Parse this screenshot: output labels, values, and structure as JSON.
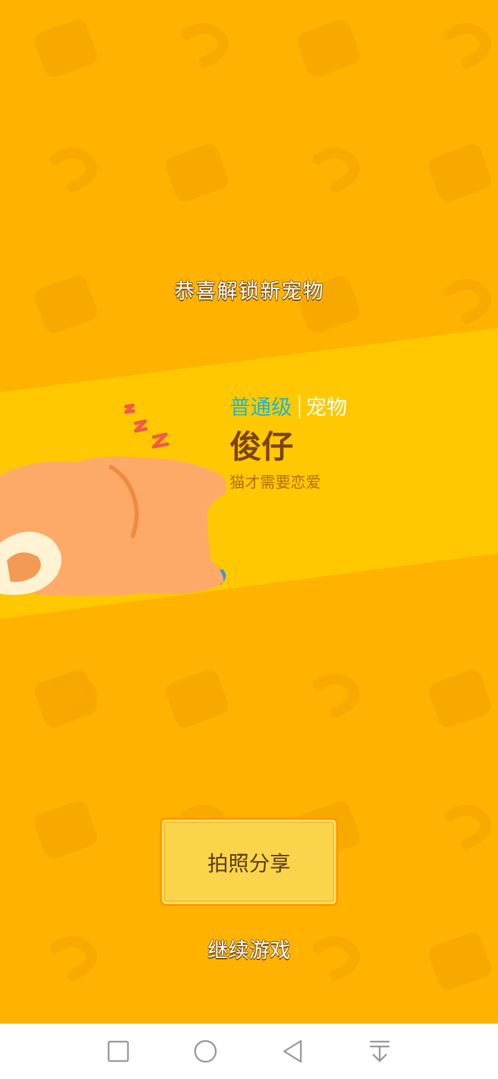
{
  "popup": {
    "headline": "恭喜解锁新宠物",
    "tier": "普通级",
    "kind": "宠物",
    "pet_name": "俊仔",
    "pet_desc": "猫才需要恋爱"
  },
  "actions": {
    "share_label": "拍照分享",
    "continue_label": "继续游戏"
  },
  "navbar": {
    "items": [
      {
        "icon": "square-icon",
        "name": "recent-apps"
      },
      {
        "icon": "circle-icon",
        "name": "home"
      },
      {
        "icon": "triangle-back-icon",
        "name": "back"
      },
      {
        "icon": "pull-down-icon",
        "name": "notifications"
      }
    ]
  },
  "colors": {
    "background": "#FFB300",
    "banner": "#FFC800",
    "tier": "#1fb7c8",
    "pet_name": "#7a4310",
    "button": "#FAD54B"
  }
}
